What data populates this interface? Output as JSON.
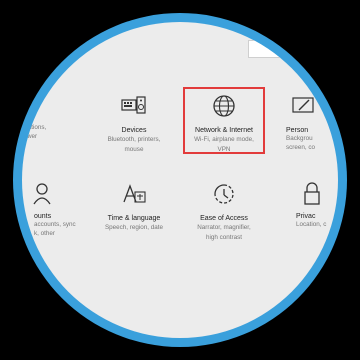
{
  "tiles": {
    "accounts_partial": {
      "title": "ounts",
      "desc1": "accounts, sync",
      "desc2": "k, other"
    },
    "system_partial": {
      "desc1": "ifications,",
      "desc2": "power"
    },
    "devices": {
      "title": "Devices",
      "desc1": "Bluetooth, printers,",
      "desc2": "mouse"
    },
    "network": {
      "title": "Network & Internet",
      "desc1": "Wi-Fi, airplane mode,",
      "desc2": "VPN"
    },
    "personalization_partial": {
      "title": "Person",
      "desc1": "Backgrou",
      "desc2": "screen, co"
    },
    "time_language": {
      "title": "Time & language",
      "desc1": "Speech, region, date"
    },
    "ease_of_access": {
      "title": "Ease of Access",
      "desc1": "Narrator, magnifier,",
      "desc2": "high contrast"
    },
    "privacy_partial": {
      "title": "Privac",
      "desc1": "Location, c"
    }
  },
  "icons": {
    "devices": "keyboard-speaker-icon",
    "network": "globe-icon",
    "time_language": "language-icon",
    "ease_of_access": "ease-of-access-icon",
    "accounts": "person-icon",
    "privacy": "lock-icon",
    "personalization": "brush-icon"
  },
  "colors": {
    "highlight": "#e23b3b",
    "ring": "#3aa0dc",
    "background": "#ececec"
  }
}
